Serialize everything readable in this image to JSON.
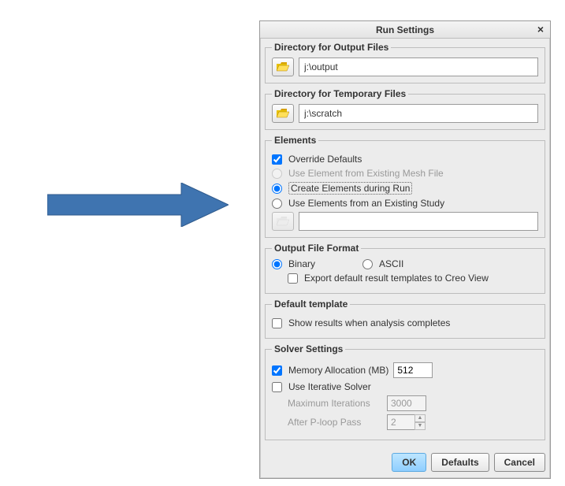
{
  "dialog": {
    "title": "Run Settings"
  },
  "output_dir": {
    "legend": "Directory for Output Files",
    "value": "j:\\output"
  },
  "temp_dir": {
    "legend": "Directory for Temporary Files",
    "value": "j:\\scratch"
  },
  "elements": {
    "legend": "Elements",
    "override_label": "Override Defaults",
    "use_existing_mesh_label": "Use Element from Existing Mesh File",
    "create_during_run_label": "Create Elements during Run",
    "use_existing_study_label": "Use Elements from an Existing Study",
    "path_value": ""
  },
  "output_format": {
    "legend": "Output File Format",
    "binary_label": "Binary",
    "ascii_label": "ASCII",
    "export_label": "Export default result templates to Creo View"
  },
  "default_template": {
    "legend": "Default template",
    "show_results_label": "Show results when analysis completes"
  },
  "solver": {
    "legend": "Solver Settings",
    "mem_label": "Memory Allocation (MB)",
    "mem_value": "512",
    "iterative_label": "Use Iterative Solver",
    "max_iter_label": "Maximum  Iterations",
    "max_iter_value": "3000",
    "after_ploop_label": "After P-loop Pass",
    "after_ploop_value": "2"
  },
  "buttons": {
    "ok": "OK",
    "defaults": "Defaults",
    "cancel": "Cancel"
  }
}
